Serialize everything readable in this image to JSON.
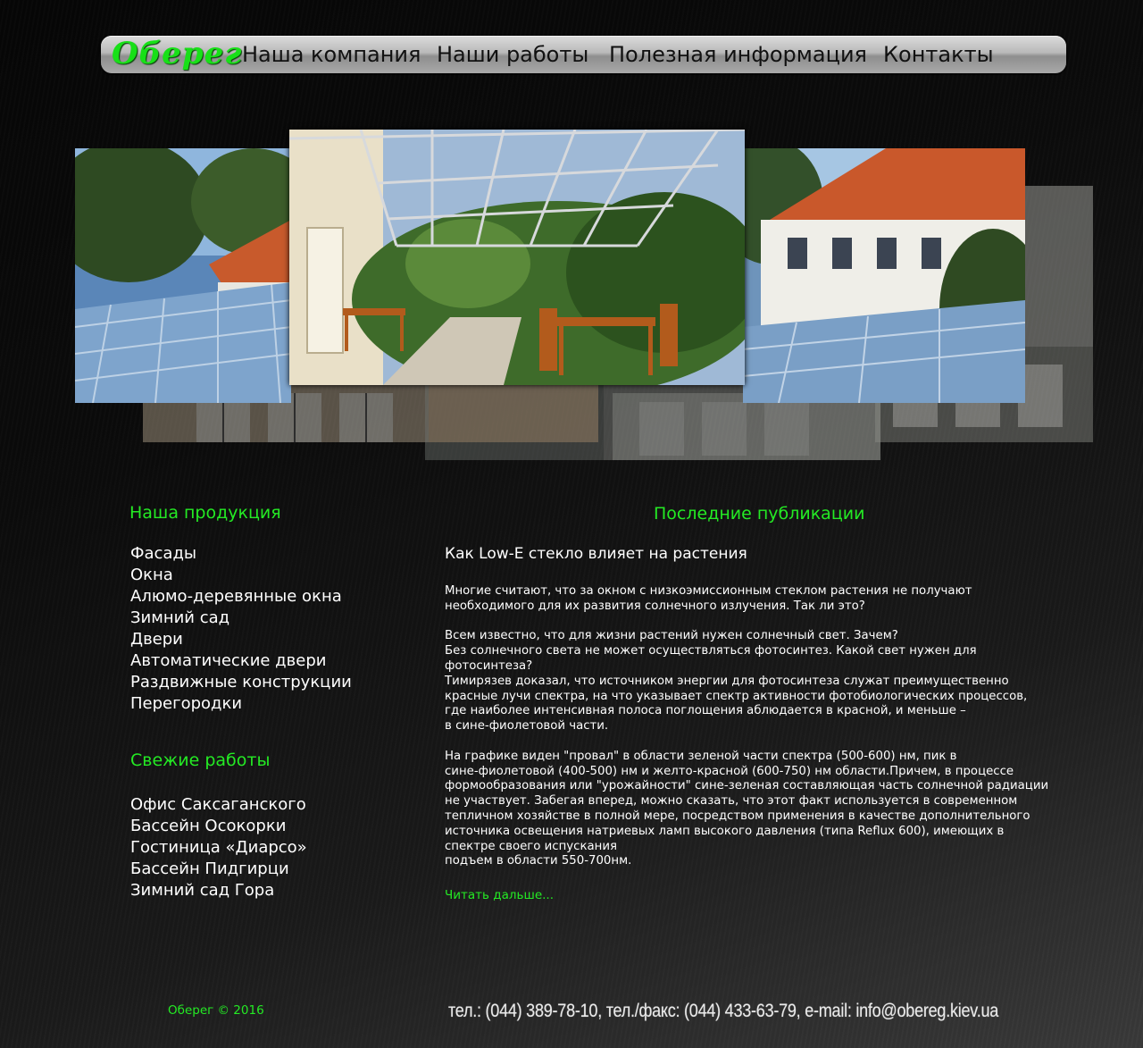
{
  "header": {
    "logo_text": "Оберег",
    "nav": [
      {
        "label": "Наша компания"
      },
      {
        "label": "Наши работы"
      },
      {
        "label": "Полезная информация"
      },
      {
        "label": "Контакты"
      }
    ]
  },
  "products": {
    "title": "Наша продукция",
    "items": [
      "Фасады",
      "Окна",
      "Алюмо-деревянные окна",
      "Зимний сад",
      "Двери",
      "Автоматические двери",
      "Раздвижные конструкции",
      "Перегородки"
    ]
  },
  "recent_works": {
    "title": "Свежие работы",
    "items": [
      "Офис Саксаганского",
      "Бассейн Осокорки",
      "Гостиница «Диарсо»",
      "Бассейн Пидгирци",
      "Зимний сад Гора"
    ]
  },
  "publications": {
    "title": "Последние публикации",
    "article_title": "Как Low-E стекло влияет на растения",
    "paragraphs": [
      "Многие считают, что за окном с низкоэмиссионным стеклом растения не получают\nнеобходимого для их развития солнечного излучения. Так ли это?",
      "Всем известно, что для жизни растений нужен солнечный свет. Зачем?\nБез солнечного света не может осуществляться фотосинтез. Какой свет нужен для\nфотосинтеза?\nТимирязев доказал, что источником энергии для фотосинтеза служат преимущественно\nкрасные лучи спектра, на что указывает спектр активности фотобиологических процессов,\nгде наиболее интенсивная полоса поглощения аблюдается в красной, и меньше –\nв сине-фиолетовой части.",
      "На графике виден \"провал\" в области зеленой части спектра (500-600) нм, пик в\nсине-фиолетовой (400-500) нм и желто-красной (600-750) нм области.Причем, в процессе\nформообразования или \"урожайности\" сине-зеленая составляющая часть солнечной радиации\nне участвует. Забегая вперед, можно сказать, что этот факт используется в современном\nтепличном хозяйстве в полной мере, посредством применения в качестве дополнительного\nисточника освещения натриевых ламп высокого давления (типа Reflux 600), имеющих в\nспектре своего испускания\nподъем в области 550-700нм."
    ],
    "read_more": "Читать дальше..."
  },
  "footer": {
    "copyright": "Оберег © 2016",
    "contacts": "тел.: (044) 389-78-10,  тел./факс: (044) 433-63-79,  e-mail: info@obereg.kiev.ua"
  },
  "colors": {
    "accent_green": "#24ea24",
    "background": "#0b0b0b",
    "nav_text": "#111111"
  }
}
